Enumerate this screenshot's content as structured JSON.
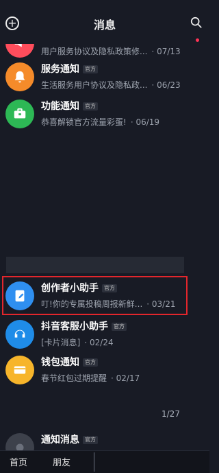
{
  "header": {
    "title": "消息",
    "add_icon": "plus-circle-icon",
    "search_icon": "search-icon"
  },
  "messages": [
    {
      "name": "",
      "official": "",
      "snippet": "用户服务协议及隐私政策修...",
      "time": "· 07/13",
      "icon": "megaphone-icon",
      "color": "#ff4d5c"
    },
    {
      "name": "服务通知",
      "official": "官方",
      "snippet": "生活服务用户协议及隐私政...",
      "time": "· 06/23",
      "icon": "bell-icon",
      "color": "#f58b2a"
    },
    {
      "name": "功能通知",
      "official": "官方",
      "snippet": "恭喜解锁官方流量彩蛋!",
      "time": "· 06/19",
      "icon": "briefcase-icon",
      "color": "#2db855"
    },
    {
      "name": "创作者小助手",
      "official": "官方",
      "snippet": "叮!你的专属投稿周报新鲜...",
      "time": "· 03/21",
      "icon": "edit-icon",
      "color": "#2f8ff0"
    },
    {
      "name": "抖音客服小助手",
      "official": "官方",
      "snippet": "[卡片消息]",
      "time": "· 02/24",
      "icon": "headset-icon",
      "color": "#1f8ce8"
    },
    {
      "name": "钱包通知",
      "official": "官方",
      "snippet": "春节红包过期提醒",
      "time": "· 02/17",
      "icon": "card-icon",
      "color": "#f7b52b"
    },
    {
      "name": "通知消息",
      "official": "官方",
      "snippet": "",
      "time": "",
      "icon": "info-icon",
      "color": "#3d414b"
    }
  ],
  "page_count": "1/27",
  "bottom_nav": {
    "home": "首页",
    "friends": "朋友"
  },
  "colors": {
    "background": "#181b25",
    "highlight": "#e3262c"
  }
}
